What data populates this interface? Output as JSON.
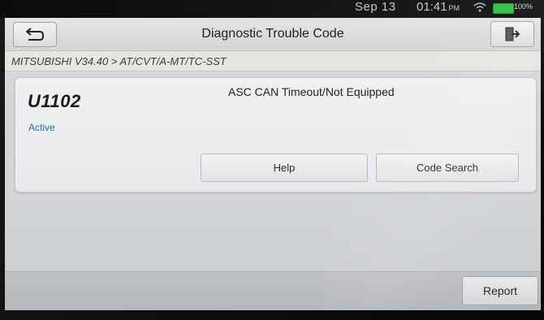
{
  "status_bar": {
    "date": "Sep 13",
    "time": "01:41",
    "ampm": "PM",
    "battery": "100%",
    "battery_color": "#38c44a"
  },
  "header": {
    "title": "Diagnostic Trouble Code",
    "back_icon": "back-arrow-icon",
    "exit_icon": "exit-door-icon"
  },
  "breadcrumb": {
    "path": "MITSUBISHI V34.40 > AT/CVT/A-MT/TC-SST"
  },
  "dtc": {
    "code": "U1102",
    "status": "Active",
    "status_color": "#1f6fd1",
    "description": "ASC CAN Timeout/Not Equipped",
    "help_label": "Help",
    "code_search_label": "Code Search"
  },
  "footer": {
    "report_label": "Report"
  }
}
